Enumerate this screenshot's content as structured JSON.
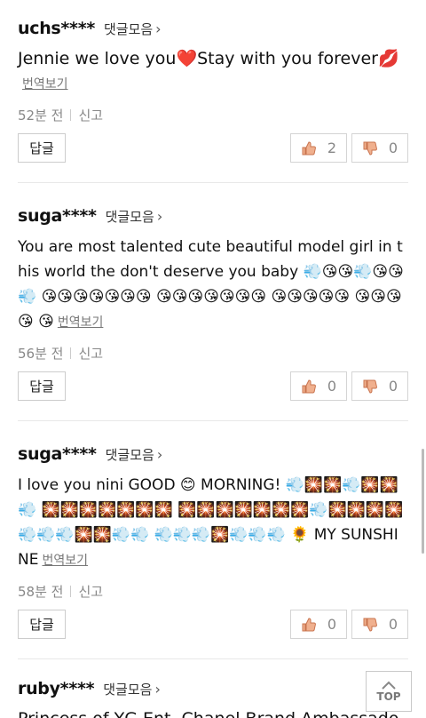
{
  "comments": [
    {
      "user": "uchs****",
      "collect_label": "댓글모음",
      "text": "Jennie we love you❤️Stay with you forever💋",
      "translate_label": "번역보기",
      "time": "52분 전",
      "report_label": "신고",
      "reply_label": "답글",
      "likes": "2",
      "dislikes": "0"
    },
    {
      "user": "suga****",
      "collect_label": "댓글모음",
      "text": "You are most talented cute beautiful model girl in this world the don't deserve you baby 💨😘😘💨😘😘💨 😘😘😘😘😘😘😘 😘😘😘😘😘😘😘 😘😘😘😘😘 😘😘😘😘 😘",
      "translate_label": "번역보기",
      "time": "56분 전",
      "report_label": "신고",
      "reply_label": "답글",
      "likes": "0",
      "dislikes": "0"
    },
    {
      "user": "suga****",
      "collect_label": "댓글모음",
      "text": "I love you nini GOOD 😊 MORNING! 💨🎇🎇💨🎇🎇💨 🎇🎇🎇🎇🎇🎇🎇 🎇🎇🎇🎇🎇🎇🎇💨🎇🎇🎇🎇💨💨💨🎇🎇💨💨 💨💨💨🎇💨💨💨 🌻 MY SUNSHINE",
      "translate_label": "번역보기",
      "time": "58분 전",
      "report_label": "신고",
      "reply_label": "답글",
      "likes": "0",
      "dislikes": "0"
    },
    {
      "user": "ruby****",
      "collect_label": "댓글모음",
      "text": "Princess of YG Ent. Chanel Brand Ambassado"
    }
  ],
  "top_button_label": "TOP",
  "icons": {
    "thumbs_up": "thumbs-up-icon",
    "thumbs_down": "thumbs-down-icon",
    "chevron": "chevron-right-icon",
    "top_arrow": "chevron-up-icon"
  },
  "colors": {
    "thumb_up": "#e8a07a",
    "thumb_down": "#e8a07a"
  }
}
